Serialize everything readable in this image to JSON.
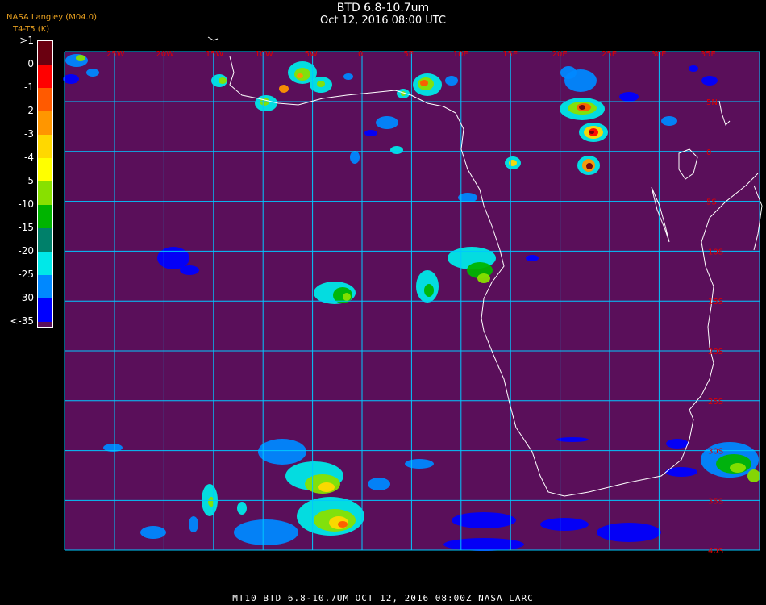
{
  "header": {
    "title": "BTD 6.8-10.7um",
    "subtitle": "Oct 12, 2016 08:00 UTC",
    "credit_line1": "NASA Langley (M04.0)",
    "credit_line2": "T4-T5 (K)"
  },
  "colorbar": {
    "labels": [
      ">1",
      "0",
      "-1",
      "-2",
      "-3",
      "-4",
      "-5",
      "-10",
      "-15",
      "-20",
      "-25",
      "-30",
      "<-35"
    ],
    "colors": [
      "#6a0010",
      "#ff0000",
      "#ff5a00",
      "#ff9600",
      "#ffd800",
      "#ffff00",
      "#88e000",
      "#00b400",
      "#00806a",
      "#00e8e8",
      "#0088ff",
      "#0000ff",
      "#5a0f5a"
    ]
  },
  "map": {
    "background": "#5a0f5a",
    "grid_color": "#00c8ff",
    "coast_color": "#ffffff",
    "lon_labels": [
      "25W",
      "20W",
      "15W",
      "10W",
      "5W",
      "0",
      "5E",
      "10E",
      "15E",
      "20E",
      "25E",
      "30E",
      "35E"
    ],
    "lat_labels": [
      "5N",
      "0",
      "5S",
      "10S",
      "15S",
      "20S",
      "25S",
      "30S",
      "35S",
      "40S"
    ],
    "label_color": "#e00000"
  },
  "footer": {
    "text": "MT10  BTD 6.8-10.7UM   OCT 12, 2016 08:00Z   NASA LARC"
  }
}
